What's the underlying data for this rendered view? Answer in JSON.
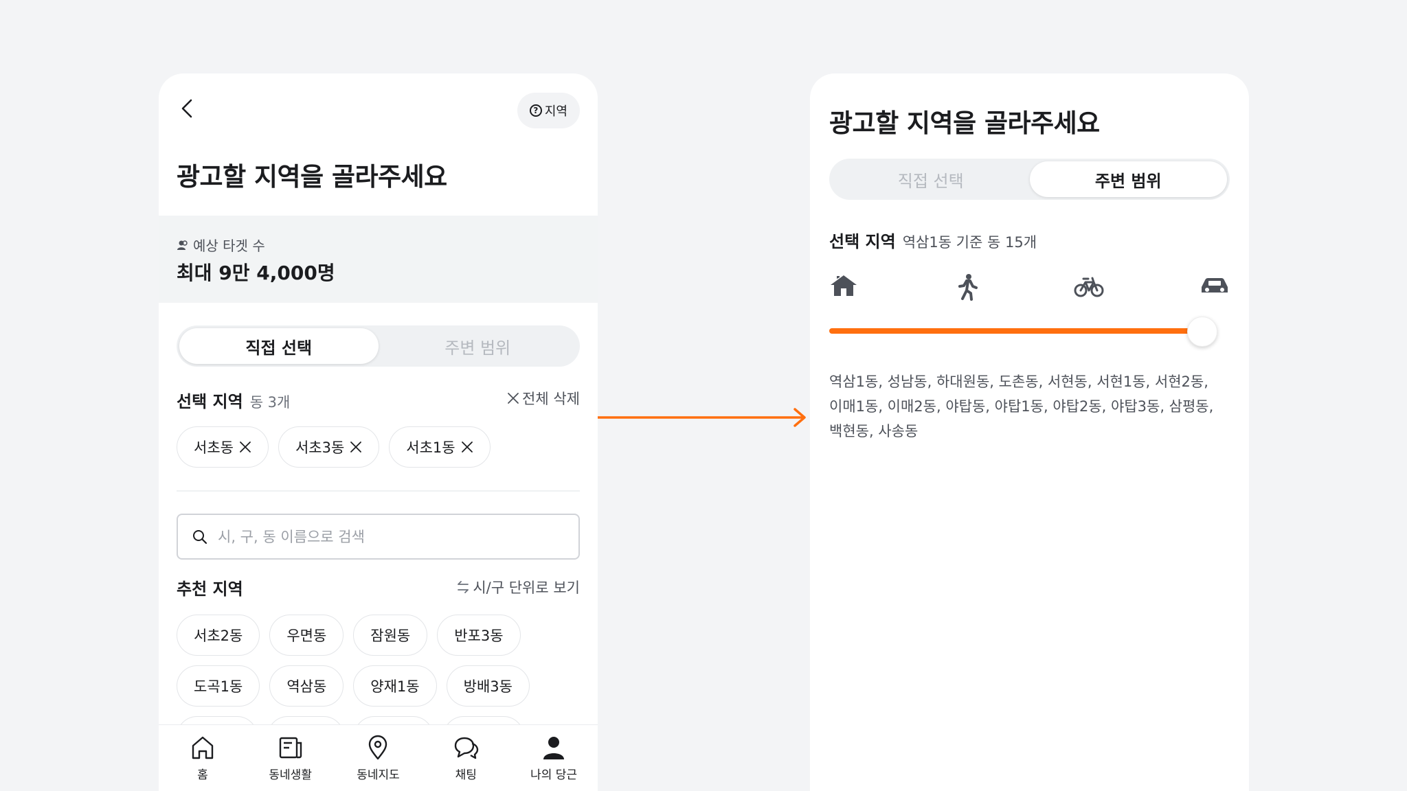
{
  "colors": {
    "accent": "#ff6f0f",
    "text": "#1b1c1f",
    "muted": "#6b7079"
  },
  "left": {
    "help_chip": {
      "icon": "question-circle-icon",
      "label": "지역"
    },
    "title": "광고할 지역을 골라주세요",
    "target": {
      "label": "예상 타겟 수",
      "value": "최대 9만 4,000명"
    },
    "tabs": [
      {
        "label": "직접 선택",
        "active": true
      },
      {
        "label": "주변 범위",
        "active": false
      }
    ],
    "selected": {
      "title": "선택 지역",
      "count": "동 3개",
      "clear_all": "전체 삭제",
      "chips": [
        "서초동",
        "서초3동",
        "서초1동"
      ]
    },
    "search": {
      "placeholder": "시, 구, 동 이름으로 검색",
      "value": ""
    },
    "recommended": {
      "title": "추천 지역",
      "toggle": "시/구 단위로 보기",
      "rows": [
        [
          "서초2동",
          "우면동",
          "잠원동",
          "반포3동"
        ],
        [
          "도곡1동",
          "역삼동",
          "양재1동",
          "방배3동"
        ]
      ]
    },
    "nav": [
      {
        "label": "홈",
        "icon": "home-icon"
      },
      {
        "label": "동네생활",
        "icon": "news-icon"
      },
      {
        "label": "동네지도",
        "icon": "map-pin-icon"
      },
      {
        "label": "채팅",
        "icon": "chat-icon"
      },
      {
        "label": "나의 당근",
        "icon": "person-icon"
      }
    ]
  },
  "right": {
    "title": "광고할 지역을 골라주세요",
    "tabs": [
      {
        "label": "직접 선택",
        "active": false
      },
      {
        "label": "주변 범위",
        "active": true
      }
    ],
    "selected": {
      "title": "선택 지역",
      "summary": "역삼1동 기준 동 15개"
    },
    "transport_icons": [
      "home-icon",
      "walk-icon",
      "bicycle-icon",
      "car-icon"
    ],
    "range_level": 1.0,
    "area_list": "역삼1동, 성남동, 하대원동, 도촌동, 서현동, 서현1동, 서현2동, 이매1동, 이매2동, 야탑동, 야탑1동, 야탑2동, 야탑3동, 삼평동, 백현동, 사송동"
  }
}
